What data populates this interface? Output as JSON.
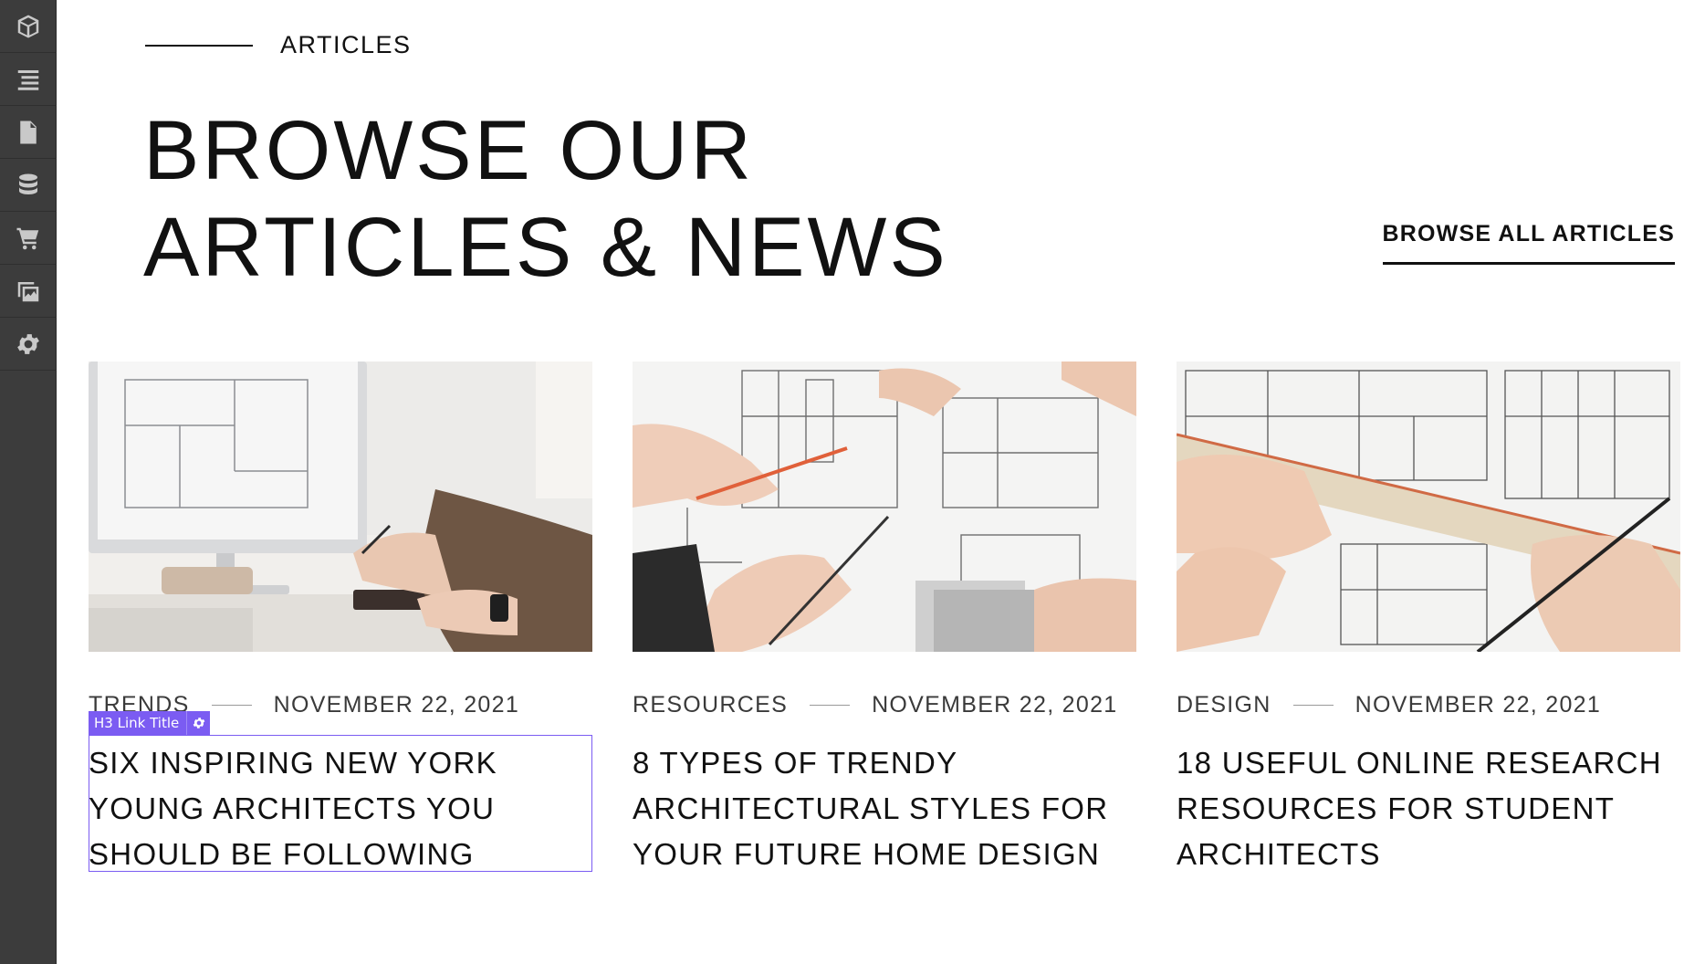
{
  "sidebar": {
    "icons": [
      "cube-icon",
      "navigator-icon",
      "pages-icon",
      "cms-database-icon",
      "ecommerce-cart-icon",
      "assets-icon",
      "settings-gear-icon"
    ]
  },
  "section": {
    "eyebrow": "ARTICLES",
    "headline_line1": "BROWSE OUR",
    "headline_line2": "ARTICLES & NEWS",
    "browse_all_label": "BROWSE ALL ARTICLES"
  },
  "articles": [
    {
      "category": "TRENDS",
      "date": "NOVEMBER 22, 2021",
      "title": "SIX INSPIRING NEW YORK YOUNG ARCHITECTS YOU SHOULD BE FOLLOWING",
      "image": "designer-at-computer-photo"
    },
    {
      "category": "RESOURCES",
      "date": "NOVEMBER 22, 2021",
      "title": "8 TYPES OF TRENDY ARCHITECTURAL STYLES FOR YOUR FUTURE HOME DESIGN",
      "image": "hands-on-blueprints-photo"
    },
    {
      "category": "DESIGN",
      "date": "NOVEMBER 22, 2021",
      "title": "18 USEFUL ONLINE RESEARCH RESOURCES FOR STUDENT ARCHITECTS",
      "image": "ruler-on-floorplan-photo"
    }
  ],
  "editor": {
    "selection_tag_prefix": "H3",
    "selection_tag_label": "Link Title",
    "accent_color": "#7b5cf2"
  }
}
